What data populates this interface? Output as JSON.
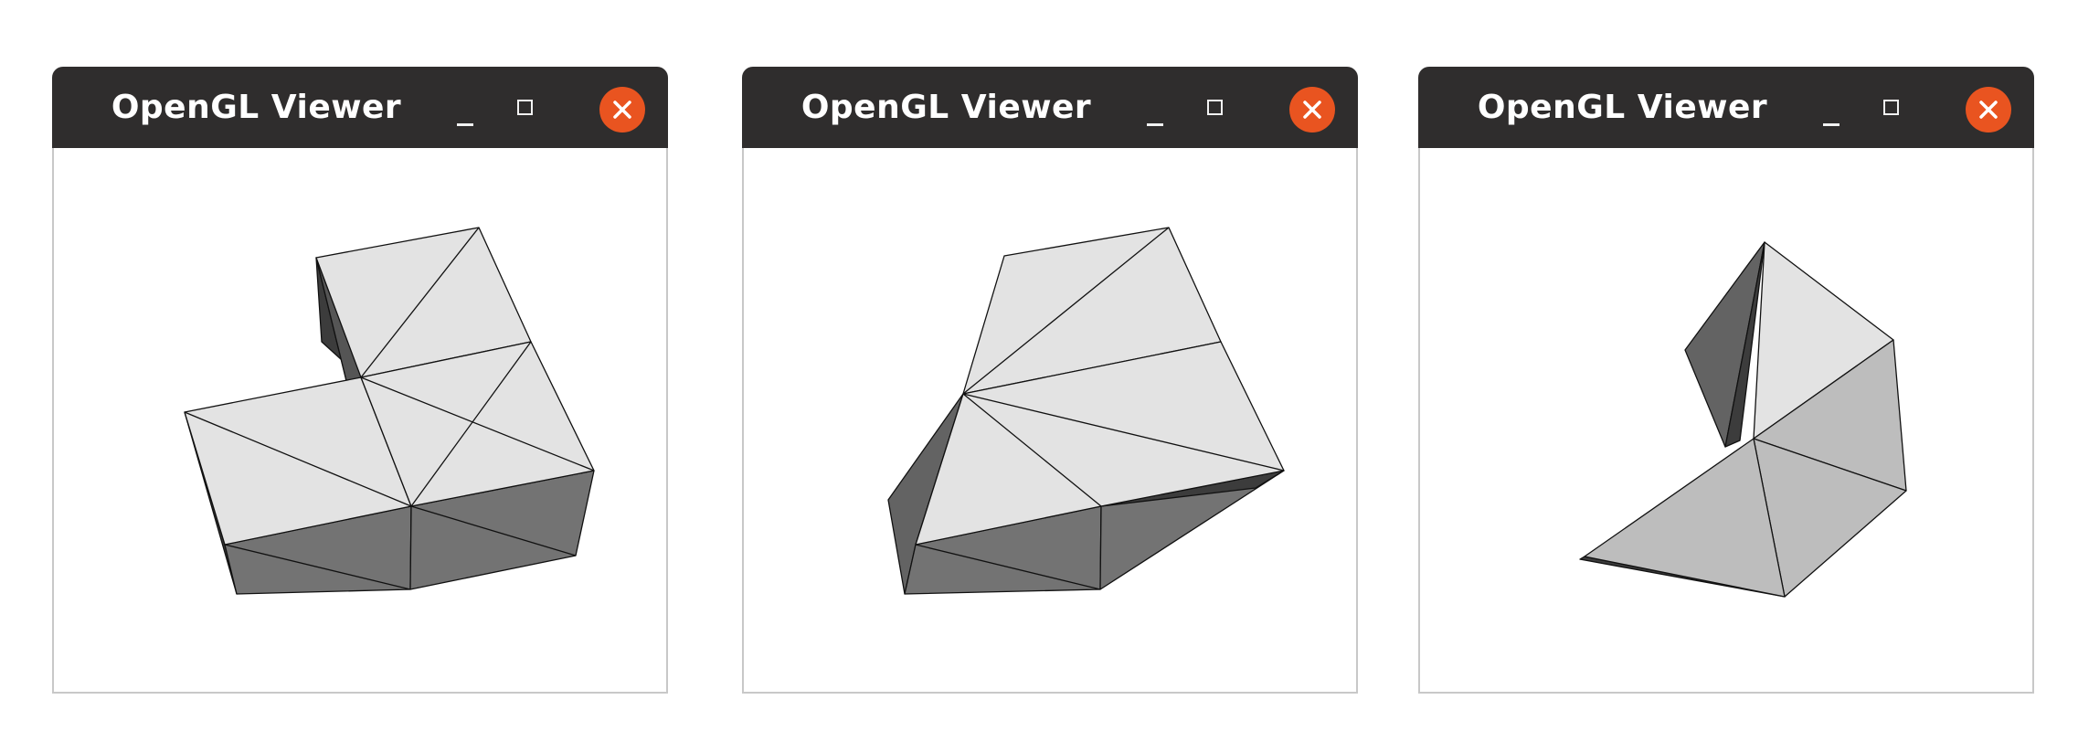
{
  "windows": [
    {
      "title": "OpenGL Viewer"
    },
    {
      "title": "OpenGL Viewer"
    },
    {
      "title": "OpenGL Viewer"
    }
  ],
  "colors": {
    "titlebar": "#2f2d2d",
    "close_button": "#e95420",
    "face_light": "#e3e3e3",
    "face_mid": "#bdbdbd",
    "face_dark": "#737373",
    "face_darker": "#636363",
    "face_darkest": "#3c3c3c",
    "edge": "#111111"
  },
  "icons": [
    "minimize-icon",
    "maximize-icon",
    "close-icon"
  ]
}
